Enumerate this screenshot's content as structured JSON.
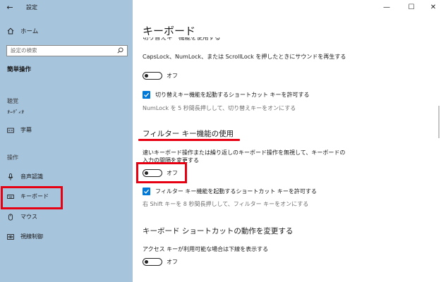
{
  "app": {
    "title": "設定"
  },
  "window": {
    "minimize_icon": "—",
    "maximize_icon": "☐",
    "close_icon": "✕"
  },
  "sidebar": {
    "home_label": "ホーム",
    "search_placeholder": "設定の検索",
    "section_title": "簡単操作",
    "group_vision": "聴覚",
    "items": [
      {
        "label": "字幕",
        "icon": "captions-icon"
      },
      {
        "label": "音声認識",
        "icon": "microphone-icon"
      },
      {
        "label": "キーボード",
        "icon": "keyboard-icon",
        "selected": true
      },
      {
        "label": "マウス",
        "icon": "mouse-icon"
      },
      {
        "label": "視線制御",
        "icon": "eye-control-icon"
      }
    ],
    "group_interaction": "操作"
  },
  "main": {
    "title": "キーボード",
    "toggle_keys": {
      "description": "CapsLock、NumLock、または ScrollLock を押したときにサウンドを再生する",
      "state": "オフ",
      "shortcut_checkbox": "切り替えキー機能を起動するショートカット キーを許可する",
      "shortcut_checked": true,
      "shortcut_hint": "NumLock を 5 秒間長押しして、切り替えキーをオンにする"
    },
    "filter_keys": {
      "heading": "フィルター キー機能の使用",
      "description_line1": "速いキーボード操作または繰り返しのキーボード操作を無視して、キーボードの",
      "description_line2": "入力の間隔を変更する",
      "state": "オフ",
      "shortcut_checkbox": "フィルター キー機能を起動するショートカット キーを許可する",
      "shortcut_checked": true,
      "shortcut_hint": "右 Shift キーを 8 秒間長押しして、フィルター キーをオンにする"
    },
    "shortcut_behavior": {
      "heading": "キーボード ショートカットの動作を変更する",
      "description": "アクセス キーが利用可能な場合は下線を表示する",
      "state": "オフ"
    }
  },
  "colors": {
    "sidebar_bg": "#a7c4dd",
    "accent": "#0078d7",
    "highlight": "#e60012"
  }
}
